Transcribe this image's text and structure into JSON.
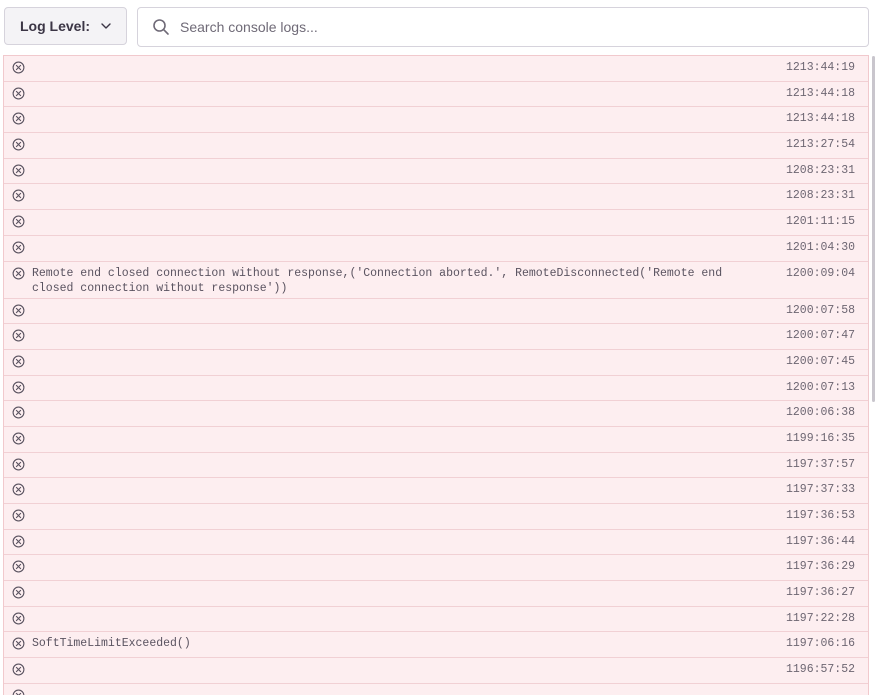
{
  "toolbar": {
    "log_level_label": "Log Level:",
    "search_placeholder": "Search console logs..."
  },
  "icons": {
    "chevron": "chevron-down-icon",
    "search": "search-icon",
    "error": "error-x-circle-icon"
  },
  "colors": {
    "row_background": "#fdeef0",
    "row_border": "#f1d0d4",
    "text": "#5a5360"
  },
  "logs": [
    {
      "message": "",
      "time": "1213:44:19"
    },
    {
      "message": "",
      "time": "1213:44:18"
    },
    {
      "message": "",
      "time": "1213:44:18"
    },
    {
      "message": "",
      "time": "1213:27:54"
    },
    {
      "message": "",
      "time": "1208:23:31"
    },
    {
      "message": "",
      "time": "1208:23:31"
    },
    {
      "message": "",
      "time": "1201:11:15"
    },
    {
      "message": "",
      "time": "1201:04:30"
    },
    {
      "message": "Remote end closed connection without response,('Connection aborted.', RemoteDisconnected('Remote end closed connection without response'))",
      "time": "1200:09:04"
    },
    {
      "message": "",
      "time": "1200:07:58"
    },
    {
      "message": "",
      "time": "1200:07:47"
    },
    {
      "message": "",
      "time": "1200:07:45"
    },
    {
      "message": "",
      "time": "1200:07:13"
    },
    {
      "message": "",
      "time": "1200:06:38"
    },
    {
      "message": "",
      "time": "1199:16:35"
    },
    {
      "message": "",
      "time": "1197:37:57"
    },
    {
      "message": "",
      "time": "1197:37:33"
    },
    {
      "message": "",
      "time": "1197:36:53"
    },
    {
      "message": "",
      "time": "1197:36:44"
    },
    {
      "message": "",
      "time": "1197:36:29"
    },
    {
      "message": "",
      "time": "1197:36:27"
    },
    {
      "message": "",
      "time": "1197:22:28"
    },
    {
      "message": "SoftTimeLimitExceeded()",
      "time": "1197:06:16"
    },
    {
      "message": "",
      "time": "1196:57:52"
    },
    {
      "message": "",
      "time": ""
    }
  ]
}
